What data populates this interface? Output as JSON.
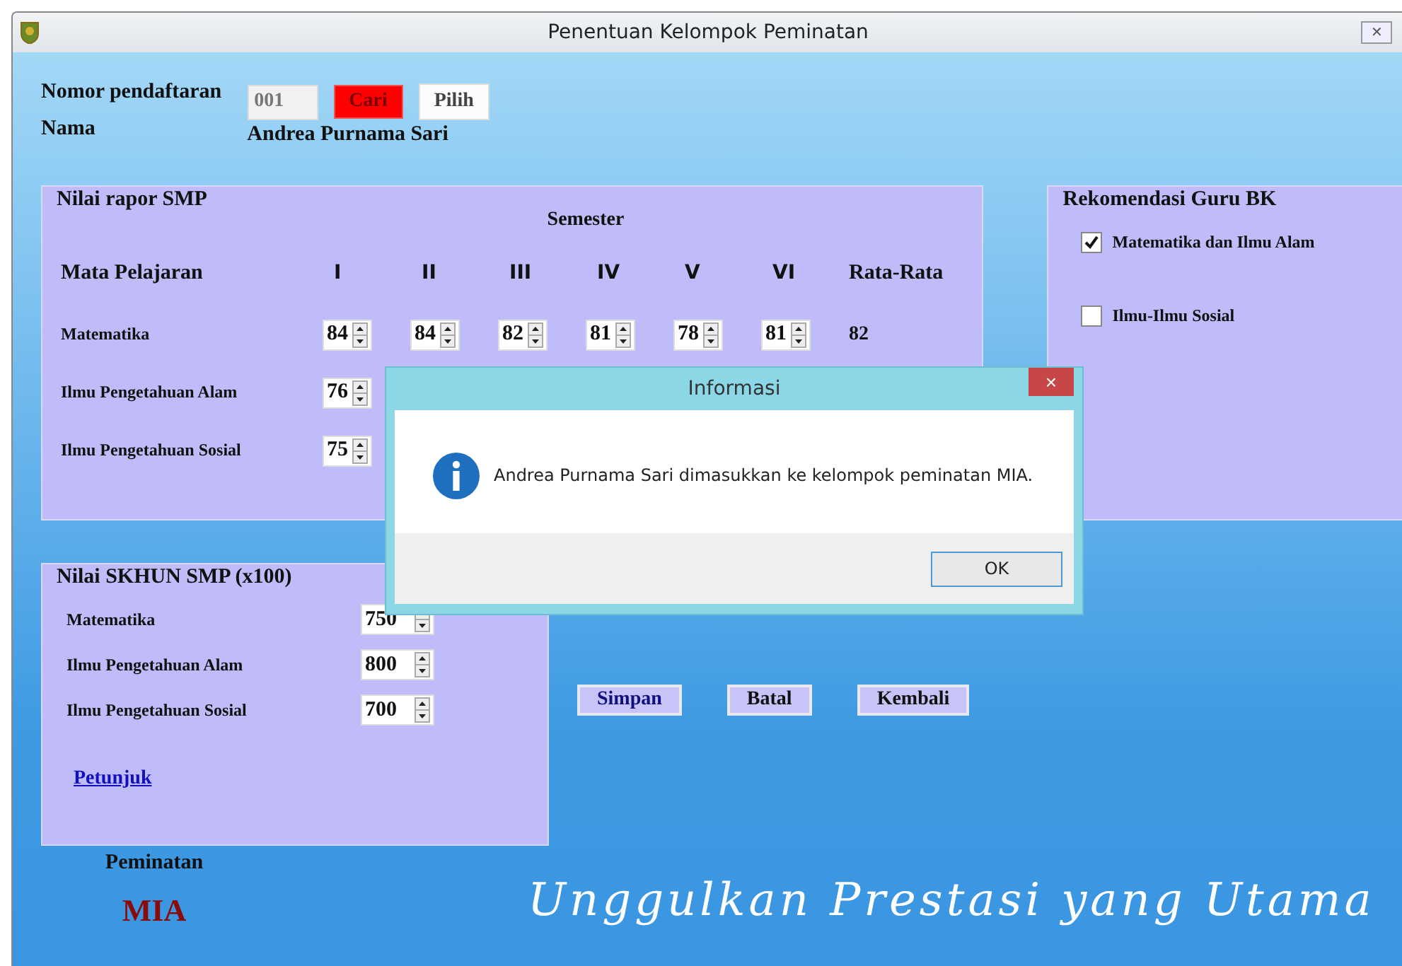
{
  "window": {
    "title": "Penentuan Kelompok Peminatan",
    "close": "✕"
  },
  "registration": {
    "number_label": "Nomor pendaftaran",
    "number_value": "001",
    "search_button": "Cari",
    "pick_button": "Pilih",
    "name_label": "Nama",
    "name_value": "Andrea Purnama Sari"
  },
  "report": {
    "title": "Nilai rapor SMP",
    "group_heading": "Semester",
    "subject_heading": "Mata Pelajaran",
    "columns": [
      "I",
      "II",
      "III",
      "IV",
      "V",
      "VI"
    ],
    "average_heading": "Rata-Rata",
    "rows": [
      {
        "subject": "Matematika",
        "grades": [
          "84",
          "84",
          "82",
          "81",
          "78",
          "81"
        ],
        "average": "82"
      },
      {
        "subject": "Ilmu Pengetahuan Alam",
        "grades": [
          "76"
        ]
      },
      {
        "subject": "Ilmu Pengetahuan Sosial",
        "grades": [
          "75"
        ]
      }
    ]
  },
  "recommendation": {
    "title": "Rekomendasi Guru BK",
    "options": [
      {
        "label": "Matematika dan Ilmu Alam",
        "checked": true
      },
      {
        "label": "Ilmu-Ilmu Sosial",
        "checked": false
      }
    ]
  },
  "exam": {
    "title": "Nilai SKHUN SMP (x100)",
    "rows": [
      {
        "subject": "Matematika",
        "value": "750"
      },
      {
        "subject": "Ilmu Pengetahuan Alam",
        "value": "800"
      },
      {
        "subject": "Ilmu Pengetahuan Sosial",
        "value": "700"
      }
    ],
    "help_link": "Petunjuk"
  },
  "actions": [
    "Simpan",
    "Batal",
    "Kembali"
  ],
  "result": {
    "label": "Peminatan",
    "value": "MIA"
  },
  "slogan": "Unggulkan Prestasi yang Utama",
  "dialog": {
    "title": "Informasi",
    "close": "×",
    "message": "Andrea Purnama Sari dimasukkan ke kelompok peminatan MIA.",
    "button": "OK"
  }
}
